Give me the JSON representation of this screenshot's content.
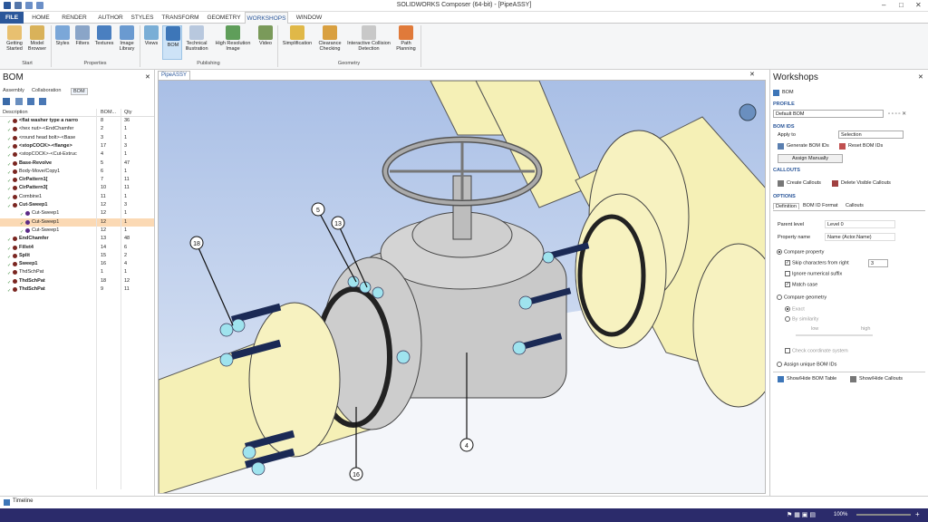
{
  "title": "SOLIDWORKS Composer (64-bit) - [PipeASSY]",
  "tabs": [
    "FILE",
    "HOME",
    "RENDER",
    "AUTHOR",
    "STYLES",
    "TRANSFORM",
    "GEOMETRY",
    "WORKSHOPS",
    "WINDOW"
  ],
  "ribbon": {
    "start": [
      "Getting Started",
      "Model Browser"
    ],
    "properties": [
      "Styles",
      "Filters",
      "Textures",
      "Image Library"
    ],
    "publishing": [
      "Views",
      "BOM",
      "Technical Illustration",
      "High Resolution Image",
      "Video"
    ],
    "geometry": [
      "Simplification",
      "Clearance Checking",
      "Interactive Collision Detection",
      "Path Planning"
    ],
    "groups": [
      "Start",
      "Properties",
      "Publishing",
      "Geometry"
    ]
  },
  "left": {
    "title": "BOM",
    "subtabs": [
      "Assembly",
      "Collaboration",
      "BOM"
    ],
    "cols": [
      "Description",
      "BOM...",
      "Qty"
    ],
    "rows": [
      {
        "name": "<flat washer type a narro",
        "bom": "8",
        "qty": "36",
        "bold": true
      },
      {
        "name": "<hex nut>-<EndChamfer",
        "bom": "2",
        "qty": "1"
      },
      {
        "name": "<round head bolt>-<Base",
        "bom": "3",
        "qty": "1"
      },
      {
        "name": "<stopCOCK>-<flange>",
        "bom": "17",
        "qty": "3",
        "bold": true
      },
      {
        "name": "<stopCOCK>-<Cut-Extruc",
        "bom": "4",
        "qty": "1"
      },
      {
        "name": "Base-Revolve",
        "bom": "5",
        "qty": "47",
        "bold": true
      },
      {
        "name": "Body-Move/Copy1",
        "bom": "6",
        "qty": "1"
      },
      {
        "name": "CirPattern1[",
        "bom": "7",
        "qty": "11",
        "bold": true
      },
      {
        "name": "CirPattern3[",
        "bom": "10",
        "qty": "11",
        "bold": true
      },
      {
        "name": "Combine1",
        "bom": "11",
        "qty": "1"
      },
      {
        "name": "Cut-Sweep1",
        "bom": "12",
        "qty": "3",
        "bold": true
      },
      {
        "name": "Cut-Sweep1",
        "bom": "12",
        "qty": "1",
        "child": true
      },
      {
        "name": "Cut-Sweep1",
        "bom": "12",
        "qty": "1",
        "child": true,
        "hl": true
      },
      {
        "name": "Cut-Sweep1",
        "bom": "12",
        "qty": "1",
        "child": true
      },
      {
        "name": "EndChamfer",
        "bom": "13",
        "qty": "48",
        "bold": true
      },
      {
        "name": "Fillet4",
        "bom": "14",
        "qty": "6",
        "bold": true
      },
      {
        "name": "Split",
        "bom": "15",
        "qty": "2",
        "bold": true
      },
      {
        "name": "Sweep1",
        "bom": "16",
        "qty": "4",
        "bold": true
      },
      {
        "name": "ThdSchPat",
        "bom": "1",
        "qty": "1"
      },
      {
        "name": "ThdSchPat",
        "bom": "18",
        "qty": "12",
        "bold": true
      },
      {
        "name": "ThdSchPat",
        "bom": "9",
        "qty": "11",
        "bold": true
      }
    ]
  },
  "viewport": {
    "tab": "PipeASSY",
    "callouts": [
      "18",
      "5",
      "13",
      "4",
      "16"
    ]
  },
  "right": {
    "title": "Workshops",
    "workshop": "BOM",
    "profile_label": "PROFILE",
    "profile_value": "Default BOM",
    "bom_ids_label": "BOM IDS",
    "apply_to_label": "Apply to",
    "apply_to_value": "Selection",
    "generate": "Generate BOM IDs",
    "reset": "Reset BOM IDs",
    "assign": "Assign Manually",
    "callouts_label": "CALLOUTS",
    "create_callouts": "Create Callouts",
    "delete_callouts": "Delete Visible Callouts",
    "options_label": "OPTIONS",
    "opt_tabs": [
      "Definition",
      "BOM ID Format",
      "Callouts"
    ],
    "parent_level_label": "Parent level",
    "parent_level_value": "Level 0",
    "property_name_label": "Property name",
    "property_name_value": "Name (Actor.Name)",
    "compare_property": "Compare property",
    "skip_chars": "Skip characters from right",
    "skip_value": "3",
    "ignore_suffix": "Ignore numerical suffix",
    "match_case": "Match case",
    "compare_geometry": "Compare geometry",
    "exact": "Exact",
    "by_similarity": "By similarity",
    "low": "low",
    "high": "high",
    "check_coord": "Check coordinate system",
    "assign_unique": "Assign unique BOM IDs",
    "show_table": "Show/Hide BOM Table",
    "show_callouts": "Show/Hide Callouts"
  },
  "timeline": "Timeline",
  "zoom": "100%"
}
